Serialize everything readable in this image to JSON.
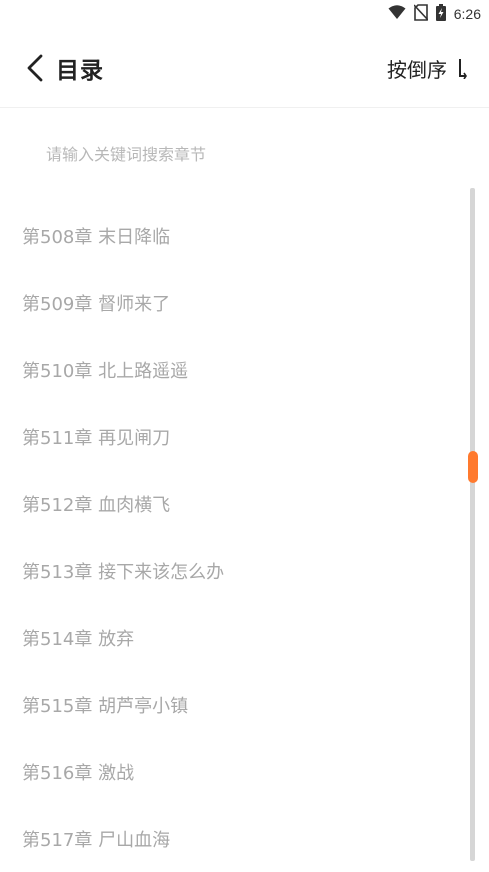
{
  "status_bar": {
    "time": "6:26",
    "icons": [
      "wifi-icon",
      "no-sim-icon",
      "battery-charging-icon"
    ]
  },
  "header": {
    "title": "目录",
    "back_icon": "chevron-left-icon",
    "sort_label": "按倒序",
    "sort_icon": "sort-descending-icon"
  },
  "search": {
    "placeholder": "请输入关键词搜索章节",
    "value": ""
  },
  "chapters": [
    {
      "label": "第508章 末日降临"
    },
    {
      "label": "第509章 督师来了"
    },
    {
      "label": "第510章 北上路遥遥"
    },
    {
      "label": "第511章 再见闸刀"
    },
    {
      "label": "第512章 血肉横飞"
    },
    {
      "label": "第513章 接下来该怎么办"
    },
    {
      "label": "第514章 放弃"
    },
    {
      "label": "第515章 胡芦亭小镇"
    },
    {
      "label": "第516章 激战"
    },
    {
      "label": "第517章 尸山血海"
    }
  ],
  "colors": {
    "accent": "#ff7a2e",
    "chapter_text": "#a8a8a8",
    "title_text": "#222222",
    "placeholder": "#b8b8b8"
  },
  "scrollbar": {
    "position": 0.41
  }
}
